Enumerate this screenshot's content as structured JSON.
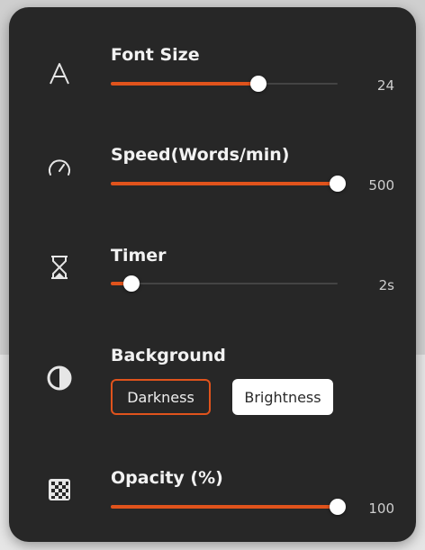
{
  "settings": {
    "font_size": {
      "icon": "font-size-icon",
      "label": "Font Size",
      "value_label": "24",
      "level_percent": 65
    },
    "speed": {
      "icon": "speedometer-icon",
      "label": "Speed(Words/min)",
      "value_label": "500",
      "level_percent": 100
    },
    "timer": {
      "icon": "hourglass-icon",
      "label": "Timer",
      "value_label": "2s",
      "level_percent": 9
    },
    "background": {
      "icon": "contrast-icon",
      "label": "Background",
      "options": [
        "Darkness",
        "Brightness"
      ],
      "selected": "Darkness"
    },
    "opacity": {
      "icon": "checkerboard-icon",
      "label": "Opacity (%)",
      "value_label": "100",
      "level_percent": 100
    }
  },
  "colors": {
    "panel_bg": "#272727",
    "accent": "#e0531c",
    "text": "#f2f2f2",
    "thumb": "#ffffff"
  }
}
